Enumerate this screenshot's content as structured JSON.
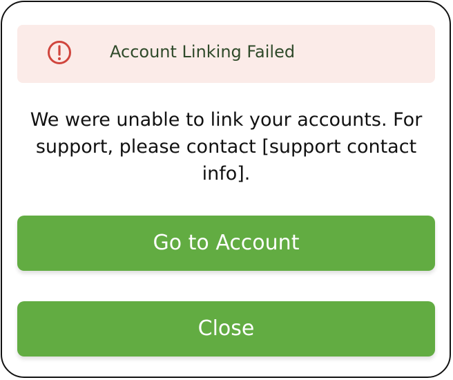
{
  "alert": {
    "title": "Account Linking Failed",
    "icon": "alert-circle-icon",
    "background_color": "#fbebe8",
    "icon_color": "#d0453d",
    "title_color": "#2f4a2a"
  },
  "message": "We were unable to link your accounts. For support, please contact [support contact info].",
  "buttons": {
    "go_to_account_label": "Go to Account",
    "close_label": "Close",
    "color": "#62ac42"
  }
}
